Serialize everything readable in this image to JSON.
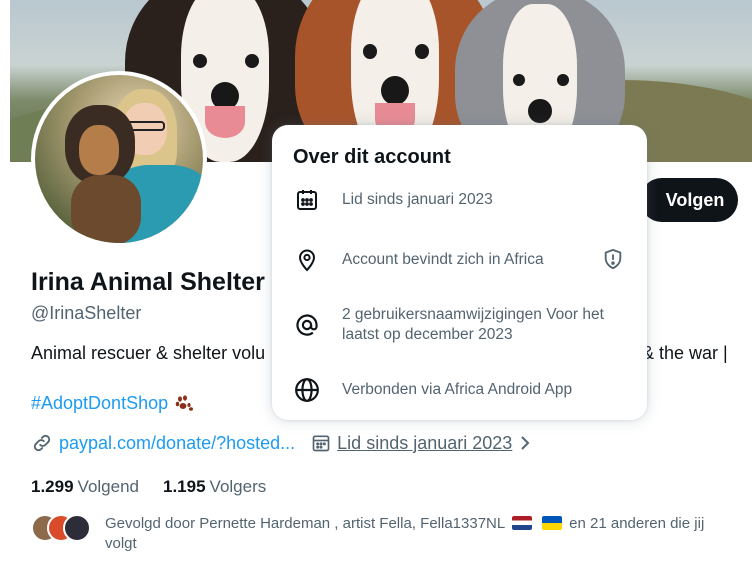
{
  "profile": {
    "name": "Irina Animal Shelter",
    "handle": "@IrinaShelter",
    "bio_start": "Animal rescuer & shelter volu",
    "bio_end": "& the war |",
    "hashtag": "#AdoptDontShop",
    "link": "paypal.com/donate/?hosted...",
    "joined": "Lid sinds januari 2023",
    "following_count": "1.299",
    "following_label": "Volgend",
    "followers_count": "1.195",
    "followers_label": "Volgers",
    "followed_by_prefix": "Gevolgd door Pernette Hardeman , artist Fella, Fella1337NL",
    "followed_by_suffix": "en 21 anderen die jij volgt"
  },
  "actions": {
    "follow_label": "Volgen"
  },
  "popover": {
    "title": "Over dit account",
    "items": [
      {
        "icon": "calendar-icon",
        "label": "Lid sinds januari 2023"
      },
      {
        "icon": "location-pin-icon",
        "label": "Account bevindt zich in Africa"
      },
      {
        "icon": "at-sign-icon",
        "label": "2 gebruikersnaamwijzigingen Voor het laatst op december 2023"
      },
      {
        "icon": "globe-icon",
        "label": "Verbonden via Africa Android App"
      }
    ]
  },
  "colors": {
    "accent": "#1d9bf0",
    "text": "#0f1419",
    "muted": "#536471",
    "button": "#0f1419"
  }
}
